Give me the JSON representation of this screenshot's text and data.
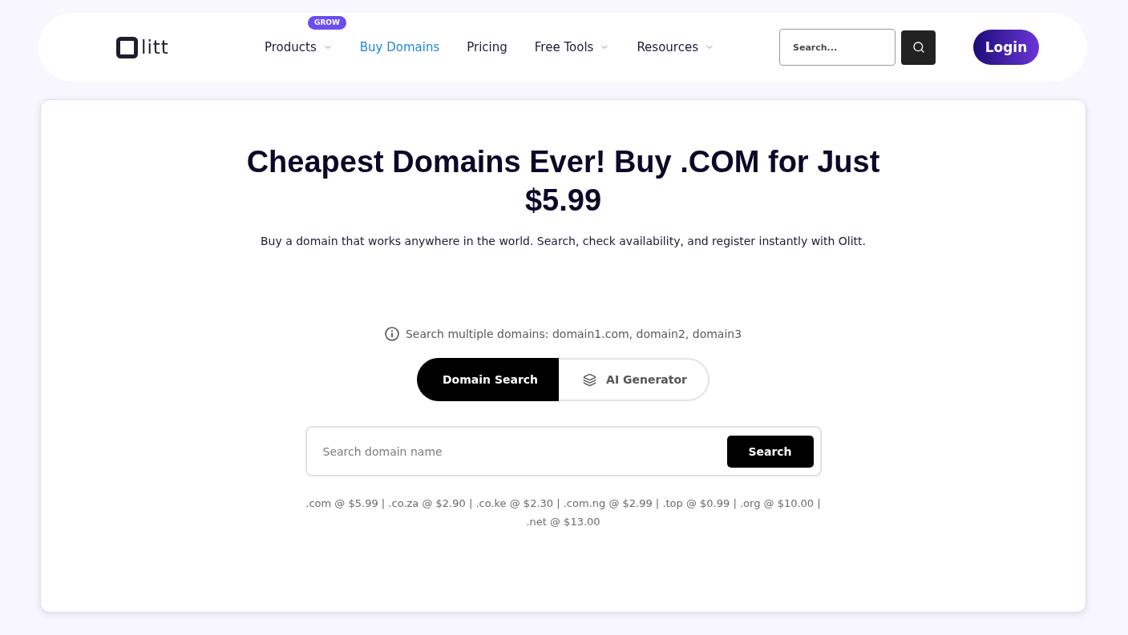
{
  "header": {
    "logo": {
      "text": "litt"
    },
    "nav": [
      {
        "label": "Products",
        "selected": false,
        "dropdown": true,
        "badge": "GROW"
      },
      {
        "label": "Buy Domains",
        "selected": true,
        "dropdown": false
      },
      {
        "label": "Pricing",
        "selected": false,
        "dropdown": false
      },
      {
        "label": "Free Tools",
        "selected": false,
        "dropdown": true
      },
      {
        "label": "Resources",
        "selected": false,
        "dropdown": true
      }
    ],
    "search": {
      "placeholder": "Search..."
    },
    "login": "Login"
  },
  "hero": {
    "title": "Cheapest Domains Ever! Buy .COM for Just $5.99",
    "subtitle": "Buy a domain that works anywhere in the world. Search, check availability, and register instantly with Olitt.",
    "hint": "Search multiple domains: domain1.com, domain2, domain3",
    "tabs": [
      {
        "label": "Domain Search",
        "selected": true,
        "kind": "standard"
      },
      {
        "label": "AI Generator",
        "selected": false,
        "kind": "ai"
      }
    ],
    "search": {
      "placeholder": "Search domain name",
      "button": "Search"
    },
    "prices": ".com @ $5.99 | .co.za @ $2.90 | .co.ke @ $2.30 | .com.ng @ $2.99 | .top @ $0.99 | .org @ $10.00 | .net @ $13.00"
  }
}
